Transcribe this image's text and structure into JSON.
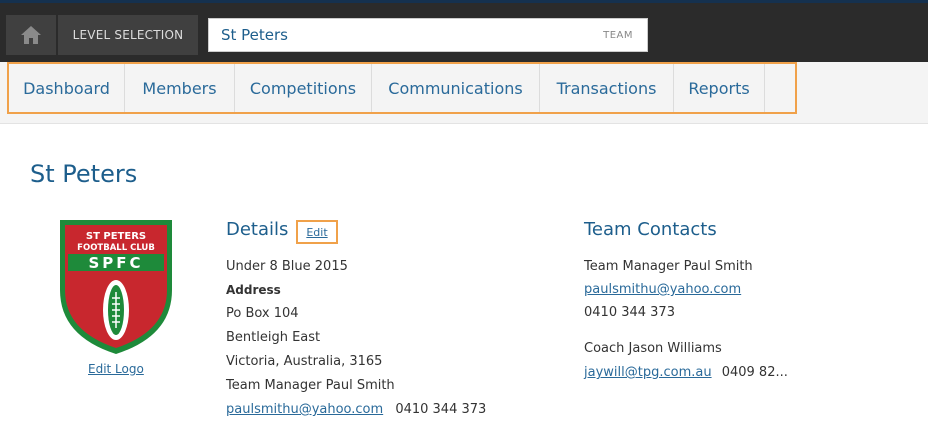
{
  "topbar": {
    "level_label": "LEVEL SELECTION",
    "level_value": "St Peters",
    "level_type": "TEAM"
  },
  "nav": [
    "Dashboard",
    "Members",
    "Competitions",
    "Communications",
    "Transactions",
    "Reports"
  ],
  "page": {
    "title": "St Peters"
  },
  "logo": {
    "line1": "ST PETERS",
    "line2": "FOOTBALL CLUB",
    "abbr": "SPFC",
    "edit_label": "Edit Logo"
  },
  "details": {
    "title": "Details",
    "edit_label": "Edit",
    "team_name": "Under 8 Blue 2015",
    "address_label": "Address",
    "address_line1": "Po Box 104",
    "address_line2": "Bentleigh East",
    "address_line3": "Victoria, Australia, 3165",
    "manager": "Team Manager Paul Smith",
    "email": "paulsmithu@yahoo.com",
    "phone": "0410 344 373"
  },
  "contacts": {
    "title": "Team Contacts",
    "items": [
      {
        "role_name": "Team Manager Paul Smith",
        "email": "paulsmithu@yahoo.com",
        "phone": "0410 344 373"
      },
      {
        "role_name": "Coach Jason Williams",
        "email": "jaywill@tpg.com.au",
        "phone": "0409 82..."
      }
    ]
  },
  "colors": {
    "accent": "#1d5e8c",
    "link": "#2a6a9a",
    "highlight": "#f0a14a",
    "logo_green": "#1e8a3a",
    "logo_red": "#c8272e"
  }
}
